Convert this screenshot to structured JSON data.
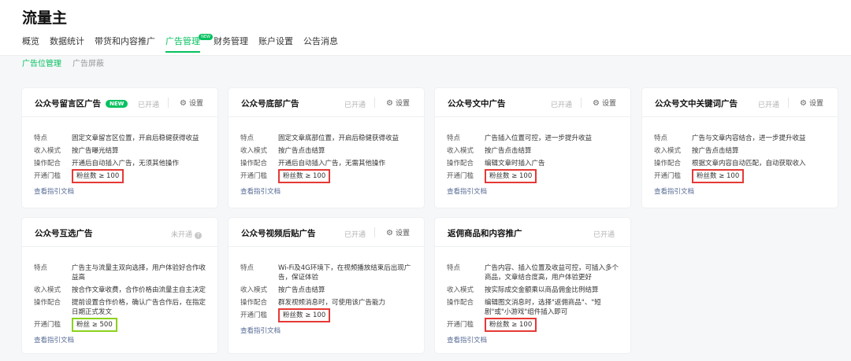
{
  "app": {
    "title": "流量主"
  },
  "nav": {
    "items": [
      {
        "label": "概览"
      },
      {
        "label": "数据统计"
      },
      {
        "label": "带货和内容推广"
      },
      {
        "label": "广告管理",
        "badge": "NEW"
      },
      {
        "label": "财务管理"
      },
      {
        "label": "账户设置"
      },
      {
        "label": "公告消息"
      }
    ]
  },
  "subnav": {
    "items": [
      {
        "label": "广告位管理"
      },
      {
        "label": "广告屏蔽"
      }
    ]
  },
  "labels": {
    "feature": "特点",
    "income": "收入模式",
    "operation": "操作配合",
    "threshold": "开通门槛",
    "doc_link": "查看指引文档",
    "settings": "设置"
  },
  "cards": [
    {
      "title": "公众号留言区广告",
      "badge": "NEW",
      "status": "已开通",
      "feature": "固定文章留言区位置，开启后稳健获得收益",
      "income": "按广告曝光结算",
      "operation": "开通后自动插入广告，无须其他操作",
      "threshold": "粉丝数 ≥ 100"
    },
    {
      "title": "公众号底部广告",
      "status": "已开通",
      "feature": "固定文章底部位置，开启后稳健获得收益",
      "income": "按广告点击结算",
      "operation": "开通后自动插入广告，无需其他操作",
      "threshold": "粉丝数 ≥ 100"
    },
    {
      "title": "公众号文中广告",
      "status": "已开通",
      "feature": "广告插入位置可控，进一步提升收益",
      "income": "按广告点击结算",
      "operation": "编辑文章时插入广告",
      "threshold": "粉丝数 ≥ 100"
    },
    {
      "title": "公众号文中关键词广告",
      "status": "已开通",
      "feature": "广告与文章内容结合，进一步提升收益",
      "income": "按广告点击结算",
      "operation": "根据文章内容自动匹配，自动获取收入",
      "threshold": "粉丝数 ≥ 100"
    },
    {
      "title": "公众号互选广告",
      "status": "未开通",
      "feature": "广告主与流量主双向选择，用户体验好合作收益高",
      "income": "按合作文章收费，合作价格由流量主自主决定",
      "operation": "提前设置合作价格，确认广告合作后，在指定日期正式发文",
      "threshold": "粉丝 ≥ 500"
    },
    {
      "title": "公众号视频后贴广告",
      "status": "已开通",
      "feature": "Wi-Fi及4G环境下，在视频播放结束后出现广告，保证体验",
      "income": "按广告点击结算",
      "operation": "群发视频消息时，可使用该广告能力",
      "threshold": "粉丝数 ≥ 100"
    },
    {
      "title": "返佣商品和内容推广",
      "status": "已开通",
      "feature": "广告内容、插入位置及收益可控，可插入多个商品，文章结合度高，用户体验更好",
      "income": "按实际成交金额乘以商品佣金比例结算",
      "operation": "编辑图文消息时，选择\"返佣商品\"、\"短剧\"或\"小游戏\"组件插入即可",
      "threshold": "粉丝数 ≥ 100"
    }
  ]
}
